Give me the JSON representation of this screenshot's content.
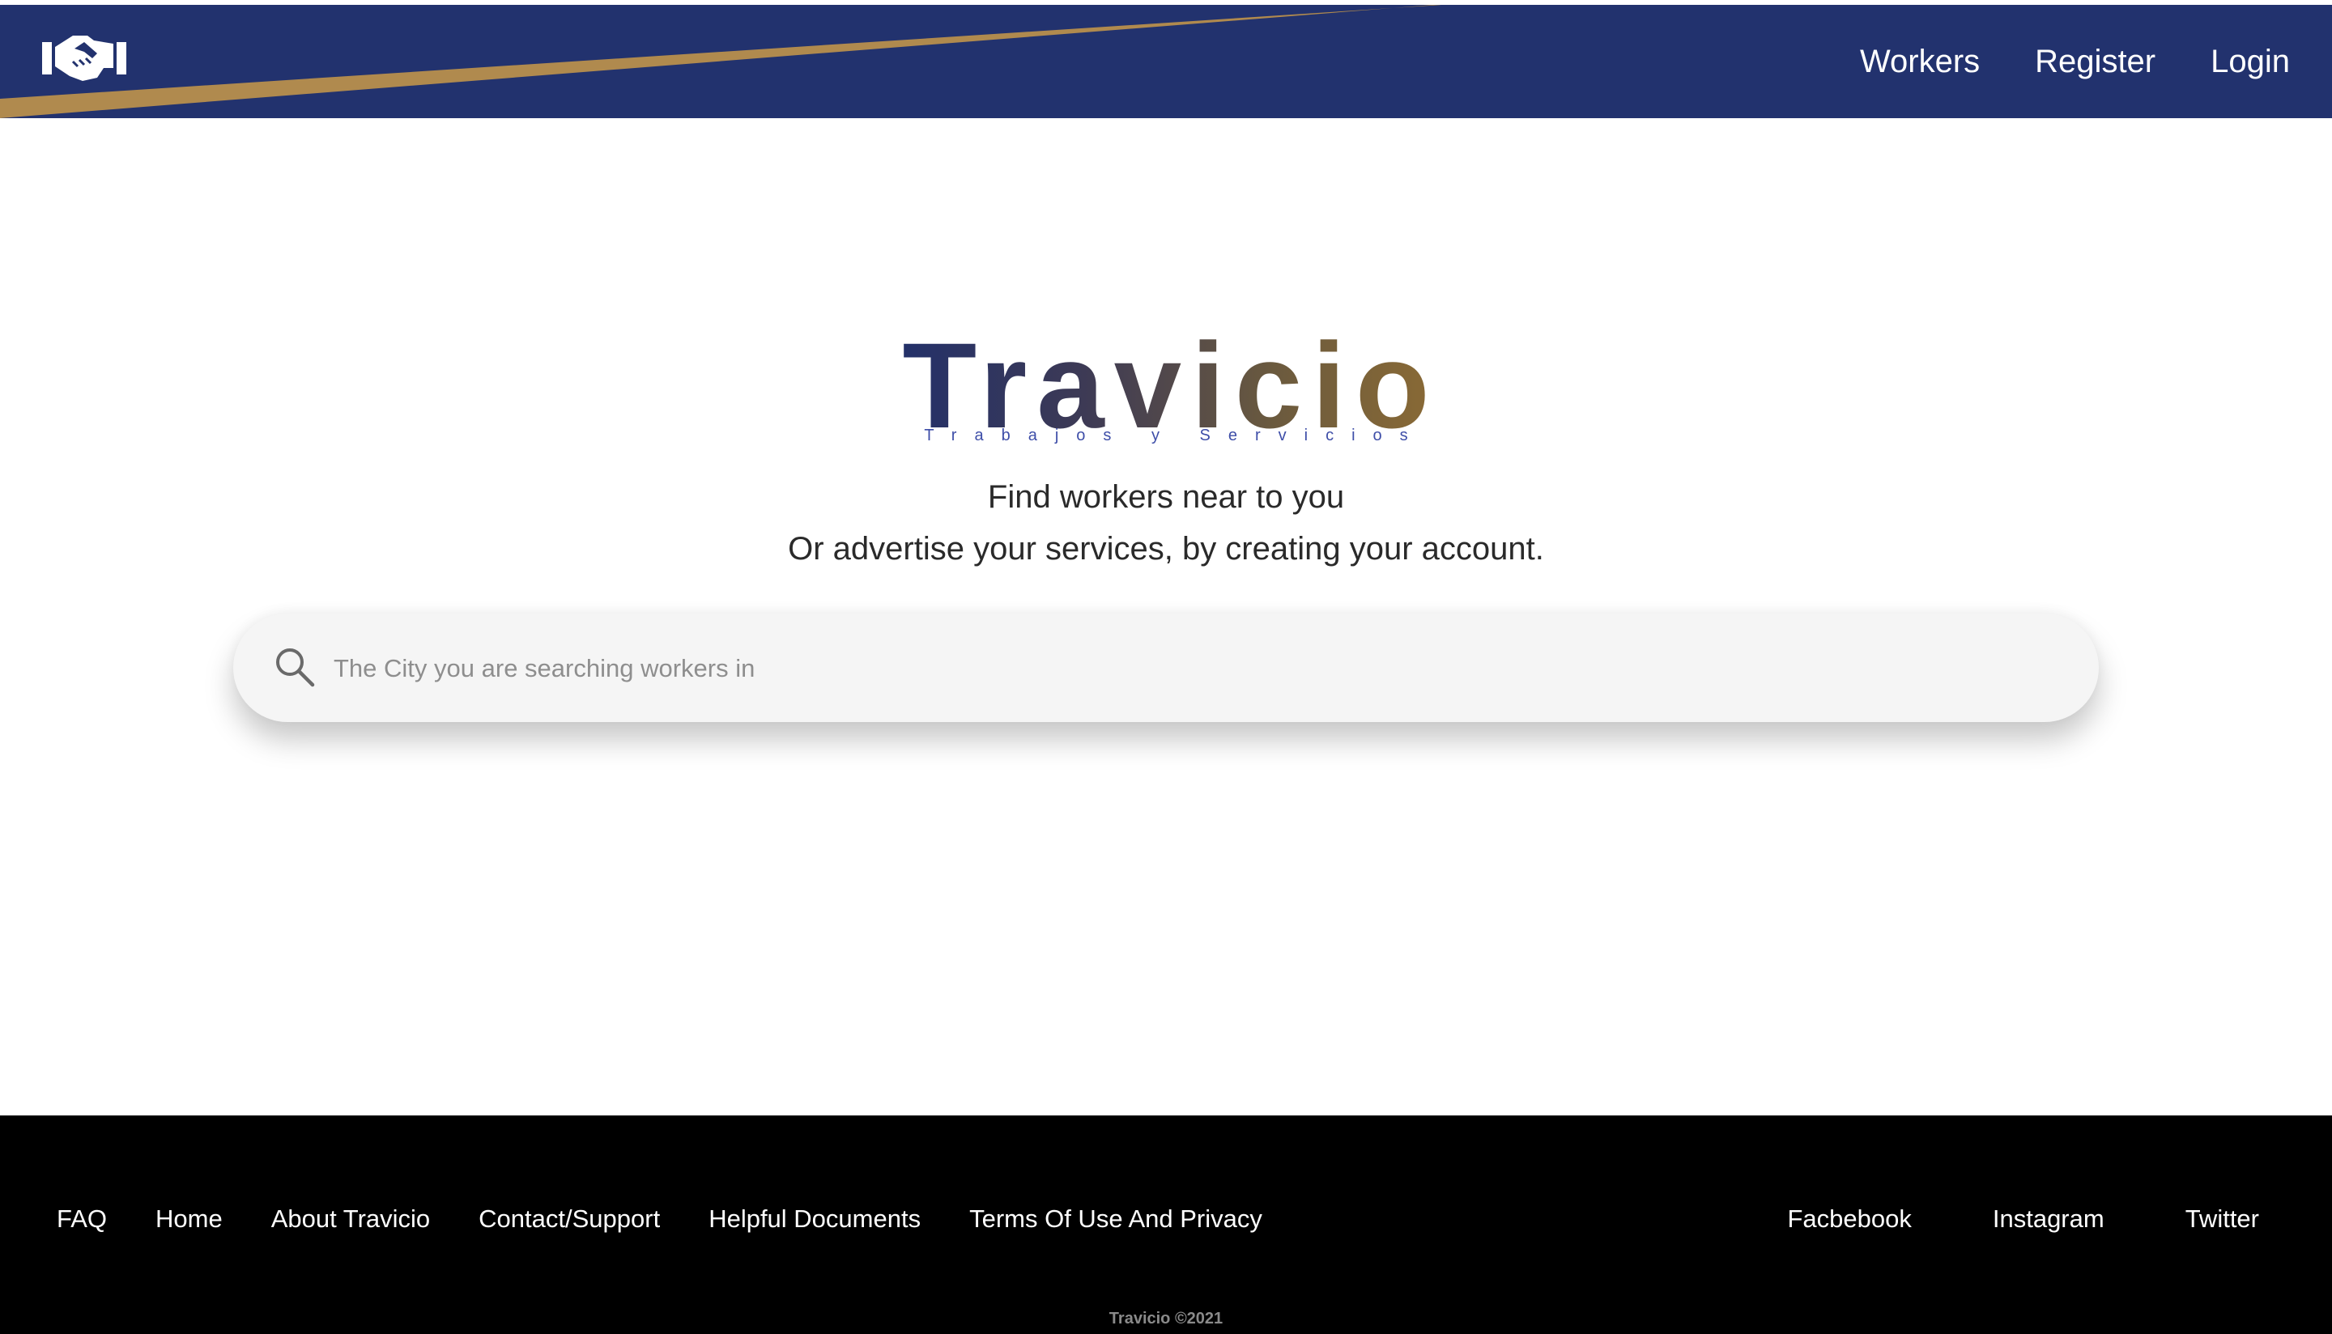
{
  "colors": {
    "header_bg": "#22326e",
    "header_stripe": "#b08a4e",
    "footer_bg": "#000000",
    "search_bg": "#f5f5f5",
    "subtitle": "#3e4ea8"
  },
  "header": {
    "logo_icon": "handshake-icon",
    "nav": {
      "workers": "Workers",
      "register": "Register",
      "login": "Login"
    }
  },
  "hero": {
    "title": "Travicio",
    "subtitle": "Trabajos y Servicios",
    "tagline_1": "Find workers near to you",
    "tagline_2": "Or advertise your services, by creating your account."
  },
  "search": {
    "icon": "search-icon",
    "placeholder": "The City you are searching workers in"
  },
  "footer": {
    "links": {
      "faq": "FAQ",
      "home": "Home",
      "about": "About Travicio",
      "contact": "Contact/Support",
      "docs": "Helpful Documents",
      "terms": "Terms Of Use And Privacy"
    },
    "social": {
      "facebook": "Facbebook",
      "instagram": "Instagram",
      "twitter": "Twitter"
    },
    "copyright": "Travicio ©2021"
  }
}
